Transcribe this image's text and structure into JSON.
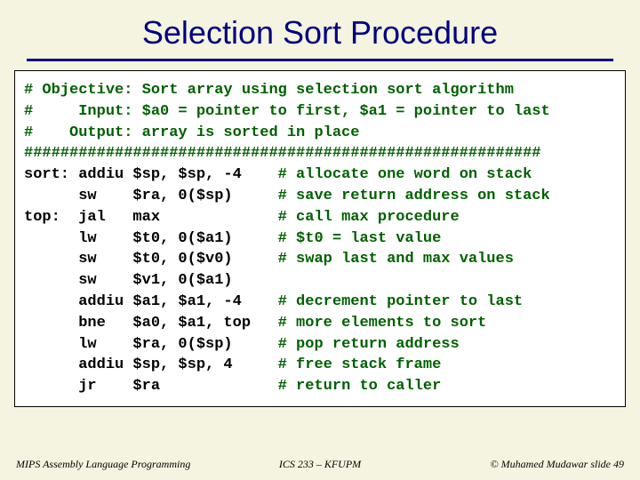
{
  "title": "Selection Sort Procedure",
  "code": [
    {
      "t": "# Objective: Sort array using selection sort algorithm",
      "c": true,
      "cstart": 0
    },
    {
      "t": "#     Input: $a0 = pointer to first, $a1 = pointer to last",
      "c": true,
      "cstart": 0
    },
    {
      "t": "#    Output: array is sorted in place",
      "c": true,
      "cstart": 0
    },
    {
      "t": "#########################################################",
      "c": true,
      "cstart": 0
    },
    {
      "t": "sort: addiu $sp, $sp, -4    # allocate one word on stack",
      "c": true,
      "cstart": 28
    },
    {
      "t": "      sw    $ra, 0($sp)     # save return address on stack",
      "c": true,
      "cstart": 28
    },
    {
      "t": "top:  jal   max             # call max procedure",
      "c": true,
      "cstart": 28
    },
    {
      "t": "      lw    $t0, 0($a1)     # $t0 = last value",
      "c": true,
      "cstart": 28
    },
    {
      "t": "      sw    $t0, 0($v0)     # swap last and max values",
      "c": true,
      "cstart": 28
    },
    {
      "t": "      sw    $v1, 0($a1)",
      "c": false,
      "cstart": 0
    },
    {
      "t": "      addiu $a1, $a1, -4    # decrement pointer to last",
      "c": true,
      "cstart": 28
    },
    {
      "t": "      bne   $a0, $a1, top   # more elements to sort",
      "c": true,
      "cstart": 28
    },
    {
      "t": "      lw    $ra, 0($sp)     # pop return address",
      "c": true,
      "cstart": 28
    },
    {
      "t": "      addiu $sp, $sp, 4     # free stack frame",
      "c": true,
      "cstart": 28
    },
    {
      "t": "      jr    $ra             # return to caller",
      "c": true,
      "cstart": 28
    }
  ],
  "footer": {
    "left": "MIPS Assembly Language Programming",
    "center": "ICS 233 – KFUPM",
    "right": "© Muhamed Mudawar   slide 49"
  }
}
